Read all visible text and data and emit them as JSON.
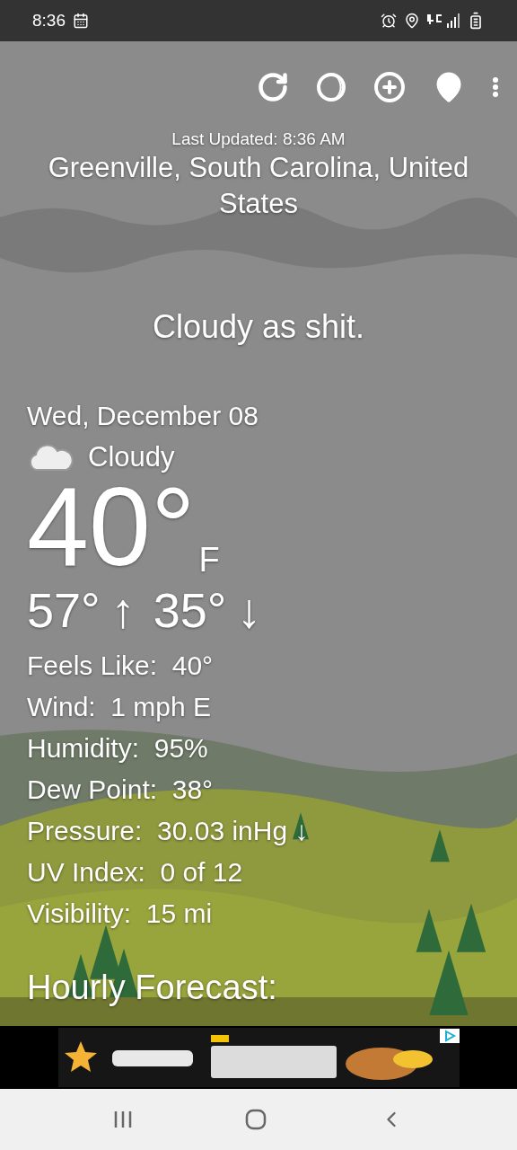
{
  "status_bar": {
    "time": "8:36"
  },
  "header": {
    "last_updated": "Last Updated: 8:36 AM",
    "location": "Greenville, South Carolina, United States"
  },
  "tagline": "Cloudy as shit.",
  "current": {
    "date": "Wed, December 08",
    "condition": "Cloudy",
    "temperature": "40°",
    "unit": "F",
    "high": "57°",
    "high_arrow": "↑",
    "low": "35°",
    "low_arrow": "↓"
  },
  "details": [
    {
      "label": "Feels Like:",
      "value": "40°"
    },
    {
      "label": "Wind:",
      "value": "1 mph E"
    },
    {
      "label": "Humidity:",
      "value": "95%"
    },
    {
      "label": "Dew Point:",
      "value": "38°"
    },
    {
      "label": "Pressure:",
      "value": "30.03 inHg ↓"
    },
    {
      "label": "UV Index:",
      "value": "0 of 12"
    },
    {
      "label": "Visibility:",
      "value": "15 mi"
    }
  ],
  "hourly_heading": "Hourly Forecast:"
}
